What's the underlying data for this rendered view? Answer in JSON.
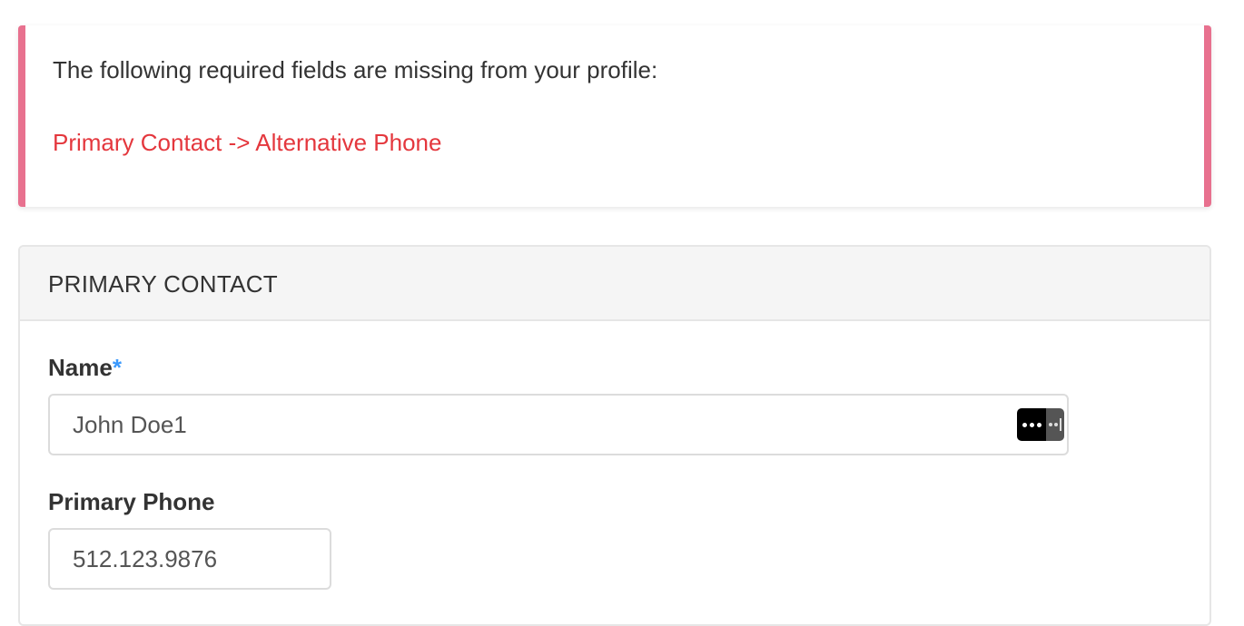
{
  "alert": {
    "message": "The following required fields are missing from your profile:",
    "missing_fields": [
      "Primary Contact -> Alternative Phone"
    ],
    "accent_color": "#e8718f",
    "error_color": "#e4373d"
  },
  "panel": {
    "title": "PRIMARY CONTACT",
    "fields": [
      {
        "label": "Name",
        "required_mark": "*",
        "value": "John Doe1",
        "password_manager_icon": "password-manager-icon"
      },
      {
        "label": "Primary Phone",
        "value": "512.123.9876"
      }
    ],
    "required_color": "#3b99fc"
  }
}
